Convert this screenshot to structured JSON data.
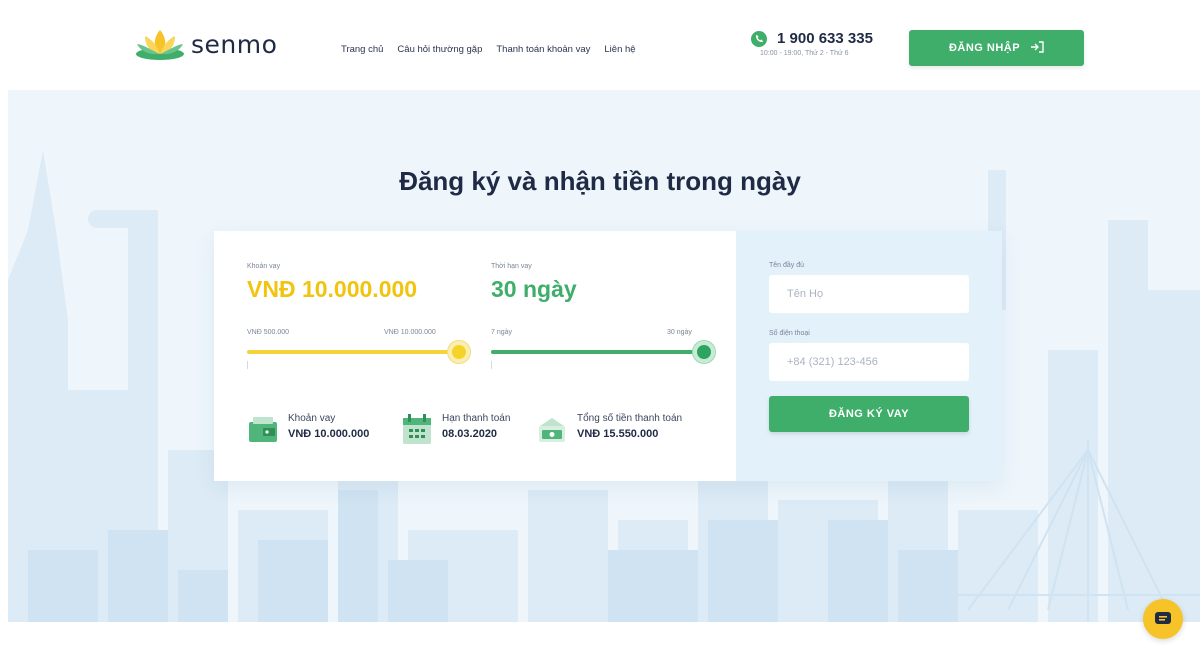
{
  "brand": {
    "name": "senmo"
  },
  "nav": {
    "items": [
      "Trang chủ",
      "Câu hỏi thường gặp",
      "Thanh toán khoản vay",
      "Liên hệ"
    ]
  },
  "contact": {
    "phone": "1 900 633 335",
    "hours": "10:00 - 19:00, Thứ 2 - Thứ 6"
  },
  "header": {
    "login_label": "ĐĂNG NHẬP"
  },
  "hero": {
    "title": "Đăng ký và nhận tiền trong ngày"
  },
  "loan": {
    "amount_label": "Khoản vay",
    "amount_value": "VNĐ 10.000.000",
    "amount_min": "VNĐ 500.000",
    "amount_max": "VNĐ 10.000.000",
    "amount_slider_fraction": 1.0,
    "term_label": "Thời hạn vay",
    "term_value": "30 ngày",
    "term_min": "7 ngày",
    "term_max": "30 ngày",
    "term_slider_fraction": 1.0
  },
  "summary": [
    {
      "label": "Khoản vay",
      "value": "VNĐ 10.000.000",
      "icon": "wallet-icon"
    },
    {
      "label": "Hạn thanh toán",
      "value": "08.03.2020",
      "icon": "calendar-icon"
    },
    {
      "label": "Tổng số tiền thanh toán",
      "value": "VNĐ 15.550.000",
      "icon": "money-icon"
    }
  ],
  "form": {
    "name_label": "Tên đầy đủ",
    "name_placeholder": "Tên Họ",
    "phone_label": "Số điện thoại",
    "phone_placeholder": "+84 (321) 123-456",
    "submit_label": "ĐĂNG KÝ VAY"
  },
  "colors": {
    "primary": "#3fae6a",
    "accent_yellow": "#f1c40f",
    "hero_bg": "#eef6fc"
  }
}
